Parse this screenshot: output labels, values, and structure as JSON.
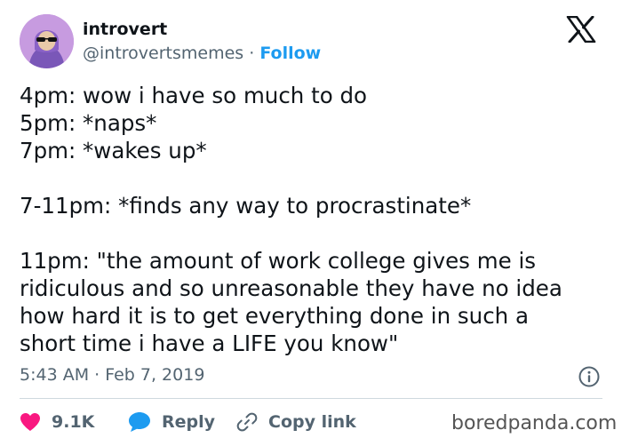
{
  "author": {
    "name": "introvert",
    "handle": "@introvertsmemes",
    "separator": "·",
    "follow_label": "Follow"
  },
  "tweet": {
    "lines": [
      "4pm: wow i have so much to do",
      "5pm: *naps*",
      "7pm: *wakes up*",
      "",
      "7-11pm: *finds any way to procrastinate*",
      "",
      "11pm: \"the amount of work college gives me is",
      "ridiculous and so unreasonable they have no idea",
      "how hard it is to get everything done in such a",
      "short time i have a LIFE you know\""
    ],
    "timestamp": "5:43 AM · Feb 7, 2019"
  },
  "actions": {
    "like_count": "9.1K",
    "reply_label": "Reply",
    "copy_link_label": "Copy link"
  },
  "watermark": "boredpanda.com",
  "icons": {
    "platform_logo": "x-logo-icon",
    "info": "info-icon",
    "like": "heart-icon",
    "reply": "speech-bubble-icon",
    "copy_link": "link-icon"
  },
  "colors": {
    "follow": "#1d9bf0",
    "heart": "#f91880",
    "reply_bubble": "#1d9bf0",
    "secondary_text": "#536471",
    "avatar_bg": "#c79be0"
  }
}
